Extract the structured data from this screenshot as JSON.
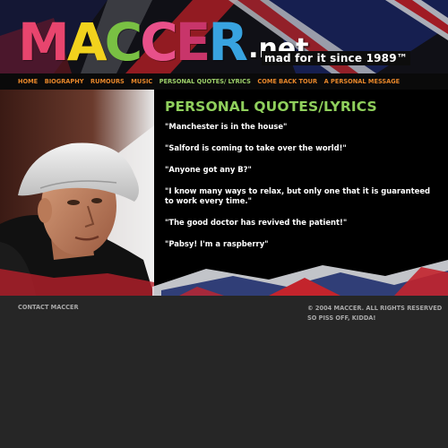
{
  "header": {
    "logo_letters": [
      {
        "char": "M",
        "color": "#e8456e"
      },
      {
        "char": "A",
        "color": "#f2d21d"
      },
      {
        "char": "C",
        "color": "#79c043"
      },
      {
        "char": "C",
        "color": "#e8508a"
      },
      {
        "char": "E",
        "color": "#c8356a"
      },
      {
        "char": "R",
        "color": "#38a3e0"
      }
    ],
    "logo_suffix": ".net",
    "tagline": "mad for it since 1989™"
  },
  "nav": {
    "items": [
      {
        "label": "HOME",
        "active": false
      },
      {
        "label": "BIOGRAPHY",
        "active": false
      },
      {
        "label": "RUMOURS",
        "active": false
      },
      {
        "label": "MUSIC",
        "active": false
      },
      {
        "label": "PERSONAL QUOTES/ LYRICS",
        "active": true
      },
      {
        "label": "COME BACK TOUR",
        "active": false
      },
      {
        "label": "A PERSONAL MESSAGE",
        "active": false
      }
    ]
  },
  "main": {
    "title": "PERSONAL QUOTES/LYRICS",
    "quotes": [
      "\"Manchester is in the house\"",
      "\"Salford is coming to take over the world!\"",
      "\"Anyone got any B?\"",
      "\"I know many ways to relax, but only one that it is guaranteed to work every time.\"",
      "\"The good doctor has revived the patient!\"",
      "\"Pabsy! I'm a raspberry\""
    ]
  },
  "footer": {
    "contact_label": "CONTACT MACCER",
    "copyright": "© 2004 MACCER. ALL RIGHTS RESERVED",
    "slogan": "SO PISS OFF, KIDDA!"
  },
  "colors": {
    "nav_link": "#e8872a",
    "nav_active": "#9ed16a",
    "title": "#8fcf5c",
    "footer_bg": "#262626"
  }
}
